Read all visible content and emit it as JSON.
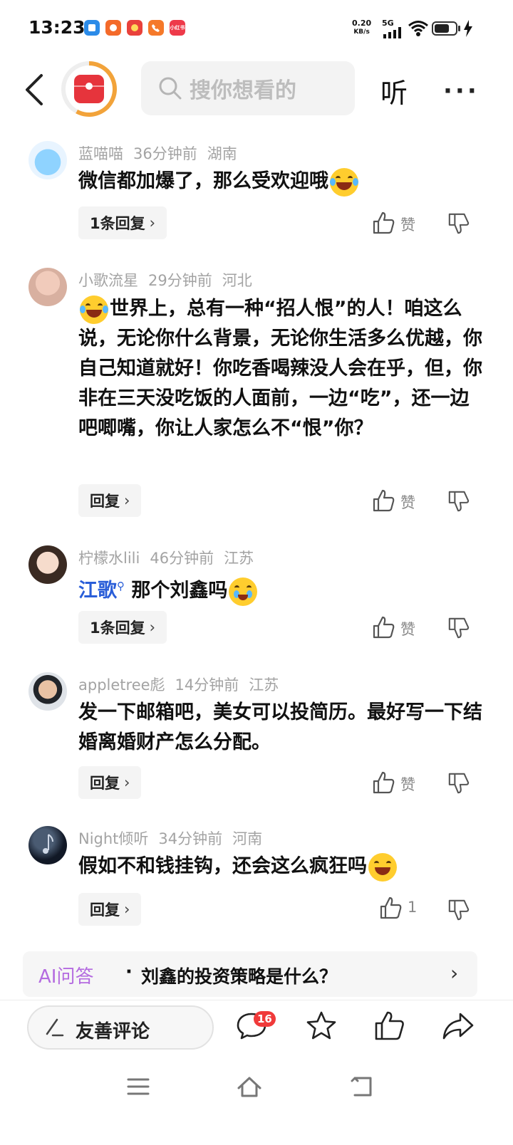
{
  "status_bar": {
    "time": "13:23",
    "net_speed_value": "0.20",
    "net_speed_unit": "KB/s",
    "network": "5G",
    "app_icons": [
      {
        "name": "app-blue",
        "color": "#2b8be8",
        "label": ""
      },
      {
        "name": "app-orange",
        "color": "#f46a2a",
        "label": ""
      },
      {
        "name": "app-red",
        "color": "#e9413b",
        "label": ""
      },
      {
        "name": "app-call",
        "color": "#f5792a",
        "label": ""
      },
      {
        "name": "app-small",
        "color": "#ee3a4a",
        "label": "小红书"
      }
    ]
  },
  "header": {
    "search_placeholder": "搜你想看的",
    "listen_label": "听",
    "more_label": "···"
  },
  "comments": [
    {
      "user": "蓝喵喵",
      "time": "36分钟前",
      "location": "湖南",
      "text": "微信都加爆了，那么受欢迎哦",
      "emoji": "laughing-crying",
      "reply_label": "1条回复",
      "like_label": "赞"
    },
    {
      "user": "小歌流星",
      "time": "29分钟前",
      "location": "河北",
      "text": "世界上，总有一种“招人恨”的人！咱这么说，无论你什么背景，无论你生活多么优越，你自己知道就好！你吃香喝辣没人会在乎，但，你非在三天没吃饭的人面前，一边“吃”，还一边吧唧嘴，你让人家怎么不“恨”你？",
      "emoji": "laughing-crying",
      "reply_label": "回复",
      "like_label": "赞"
    },
    {
      "user": "柠檬水lili",
      "time": "46分钟前",
      "location": "江苏",
      "mention": "江歌",
      "text": "那个刘鑫吗",
      "emoji": "crying",
      "reply_label": "1条回复",
      "like_label": "赞"
    },
    {
      "user": "appletree彪",
      "time": "14分钟前",
      "location": "江苏",
      "text": "发一下邮箱吧，美女可以投简历。最好写一下结婚离婚财产怎么分配。",
      "reply_label": "回复",
      "like_label": "赞"
    },
    {
      "user": "Night倾听",
      "time": "34分钟前",
      "location": "河南",
      "text": "假如不和钱挂钩，还会这么疯狂吗",
      "emoji": "grinning",
      "reply_label": "回复",
      "like_label": "1"
    }
  ],
  "ai_banner": {
    "tag": "AI问答",
    "separator": "·",
    "question": "刘鑫的投资策略是什么？",
    "chevron": "›"
  },
  "bottom_bar": {
    "input_label": "友善评论",
    "comment_count": "16"
  },
  "colors": {
    "accent_red": "#e6343c",
    "ring_orange": "#f2a33a",
    "mention_blue": "#2a5ed8",
    "ai_purple": "#b46be0",
    "badge_red": "#f03a3a"
  }
}
